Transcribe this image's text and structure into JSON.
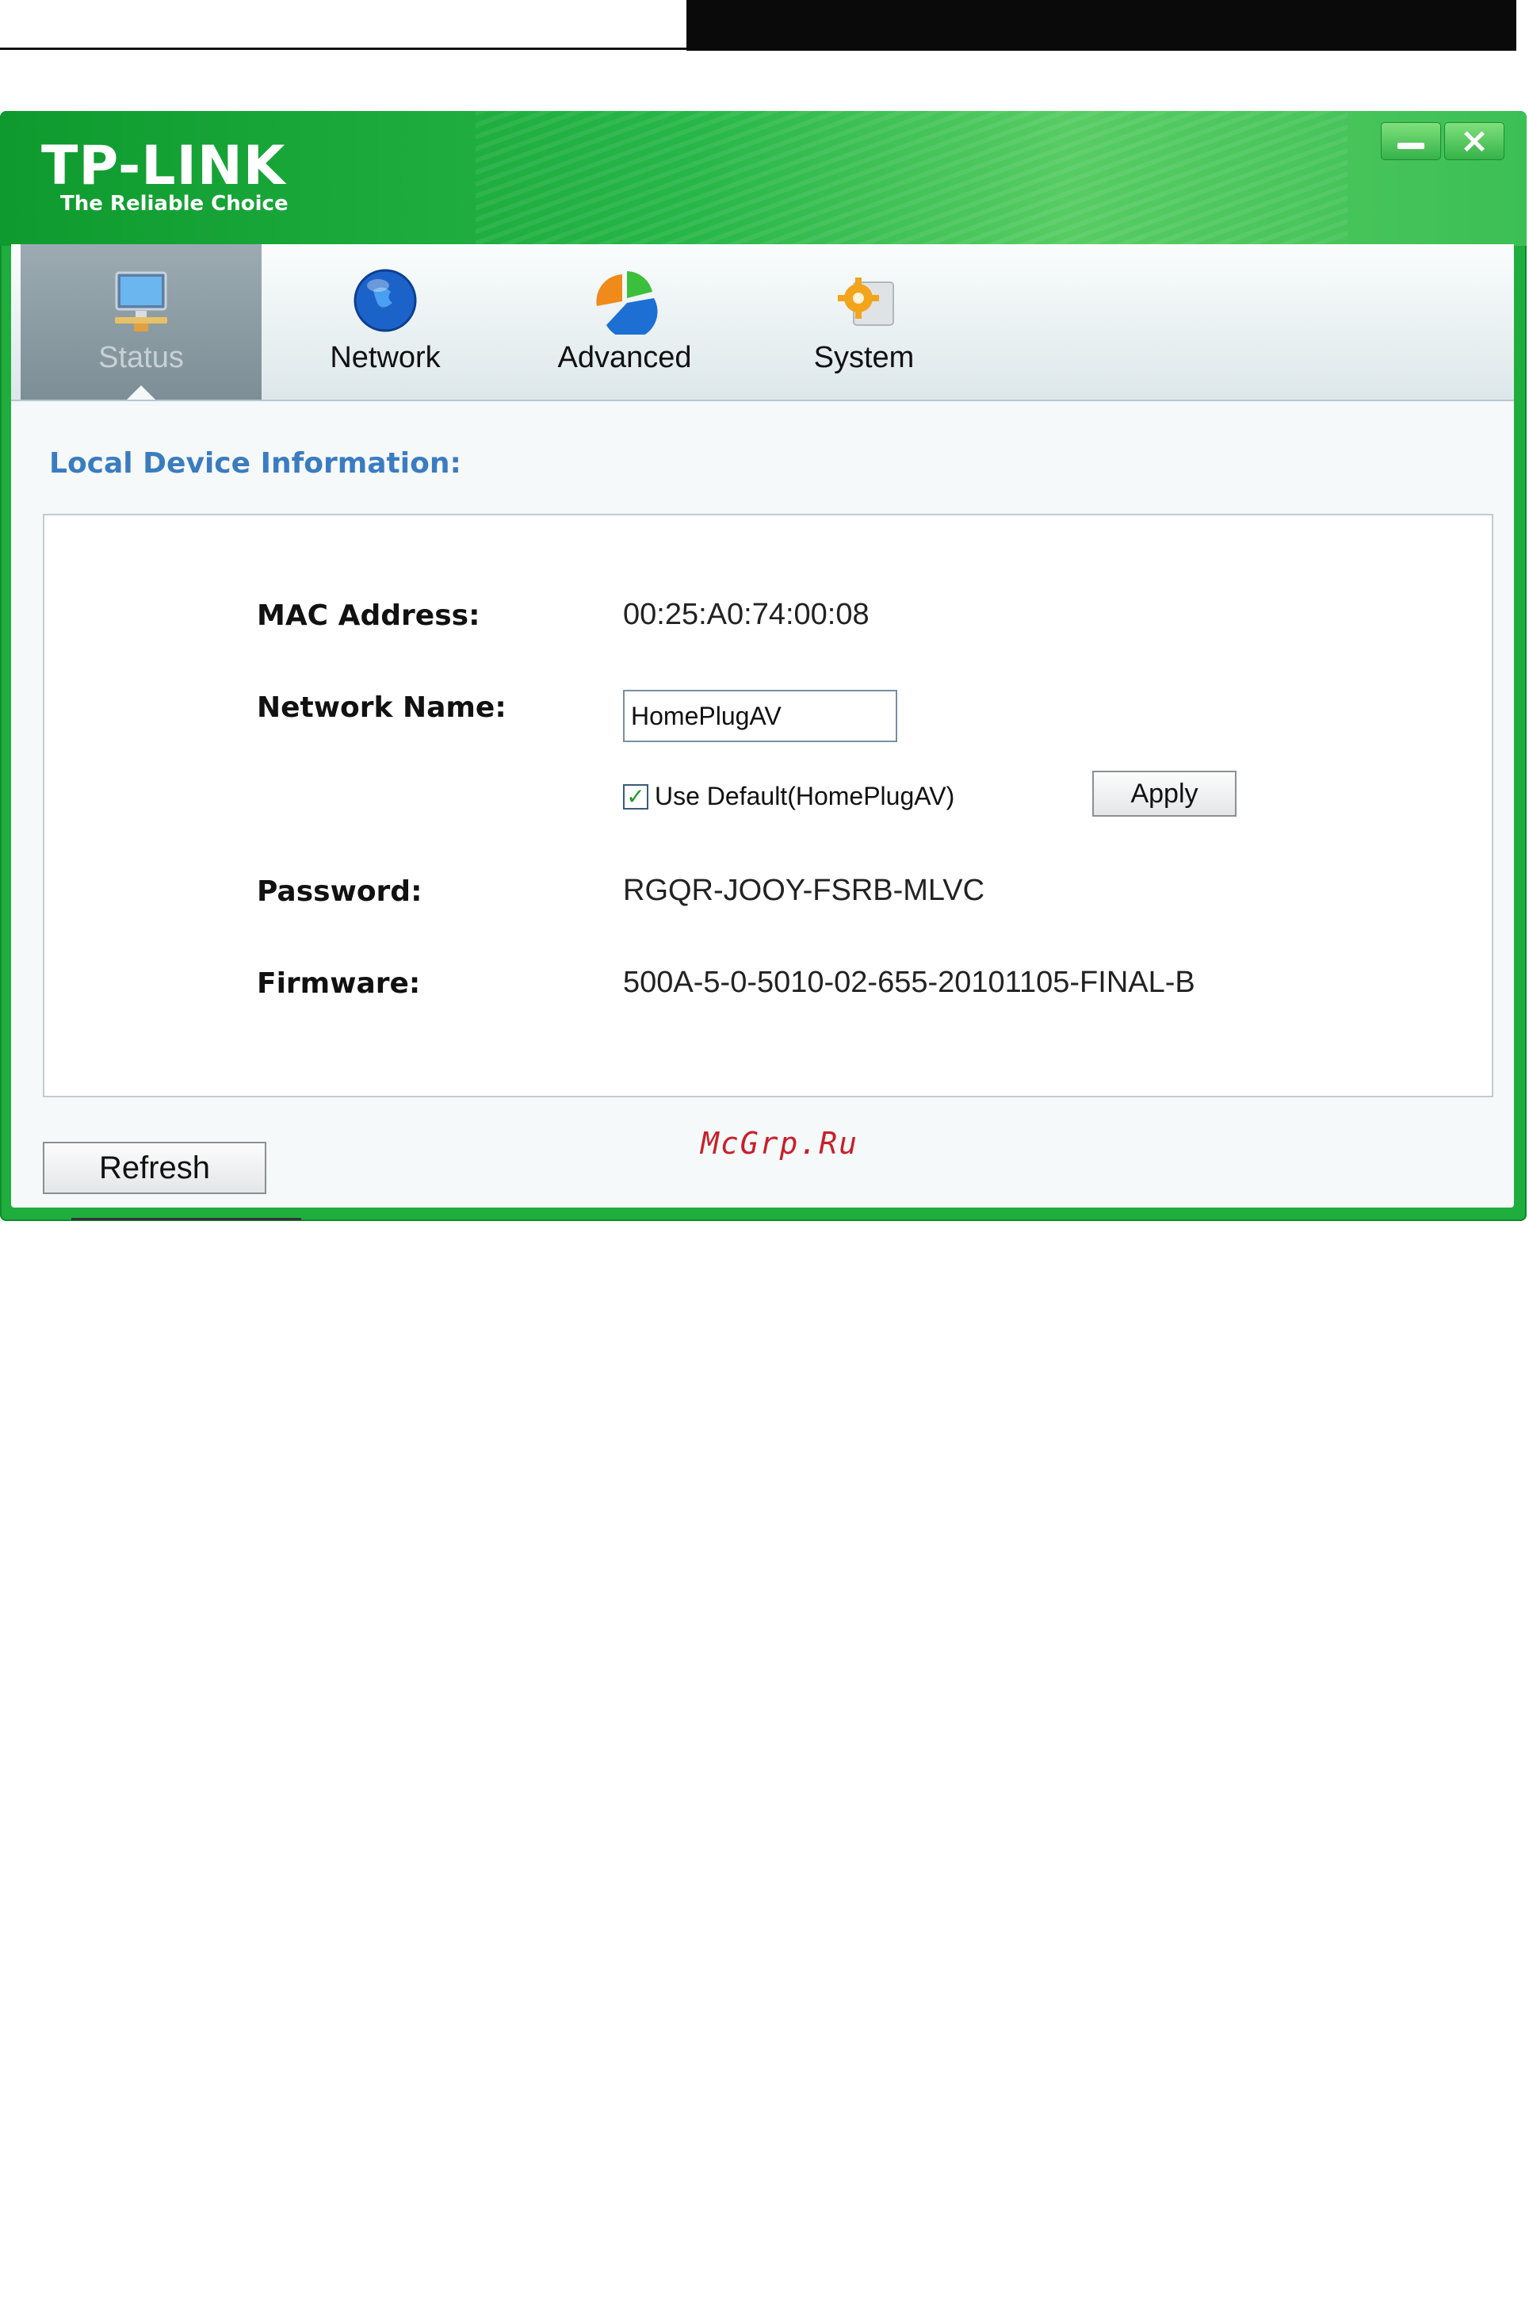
{
  "window": {
    "brand": "TP-LINK",
    "tagline": "The Reliable Choice",
    "minimize_icon": "minimize-icon",
    "close_icon": "close-icon"
  },
  "tabs": [
    {
      "label": "Status",
      "icon": "monitor-icon",
      "active": true
    },
    {
      "label": "Network",
      "icon": "globe-icon",
      "active": false
    },
    {
      "label": "Advanced",
      "icon": "pie-chart-icon",
      "active": false
    },
    {
      "label": "System",
      "icon": "gear-icon",
      "active": false
    }
  ],
  "section": {
    "title": "Local Device Information:"
  },
  "fields": {
    "mac_label": "MAC  Address:",
    "mac_value": "00:25:A0:74:00:08",
    "network_name_label": "Network Name:",
    "network_name_value": "HomePlugAV",
    "use_default_label": "Use Default(HomePlugAV)",
    "use_default_checked": true,
    "password_label": "Password:",
    "password_value": "RGQR-JOOY-FSRB-MLVC",
    "firmware_label": "Firmware:",
    "firmware_value": "500A-5-0-5010-02-655-20101105-FINAL-B"
  },
  "buttons": {
    "apply": "Apply",
    "refresh": "Refresh"
  },
  "watermark": "McGrp.Ru",
  "colors": {
    "brand_green": "#1fae3e",
    "section_blue": "#3b7cc0",
    "watermark_red": "#c8202a"
  }
}
